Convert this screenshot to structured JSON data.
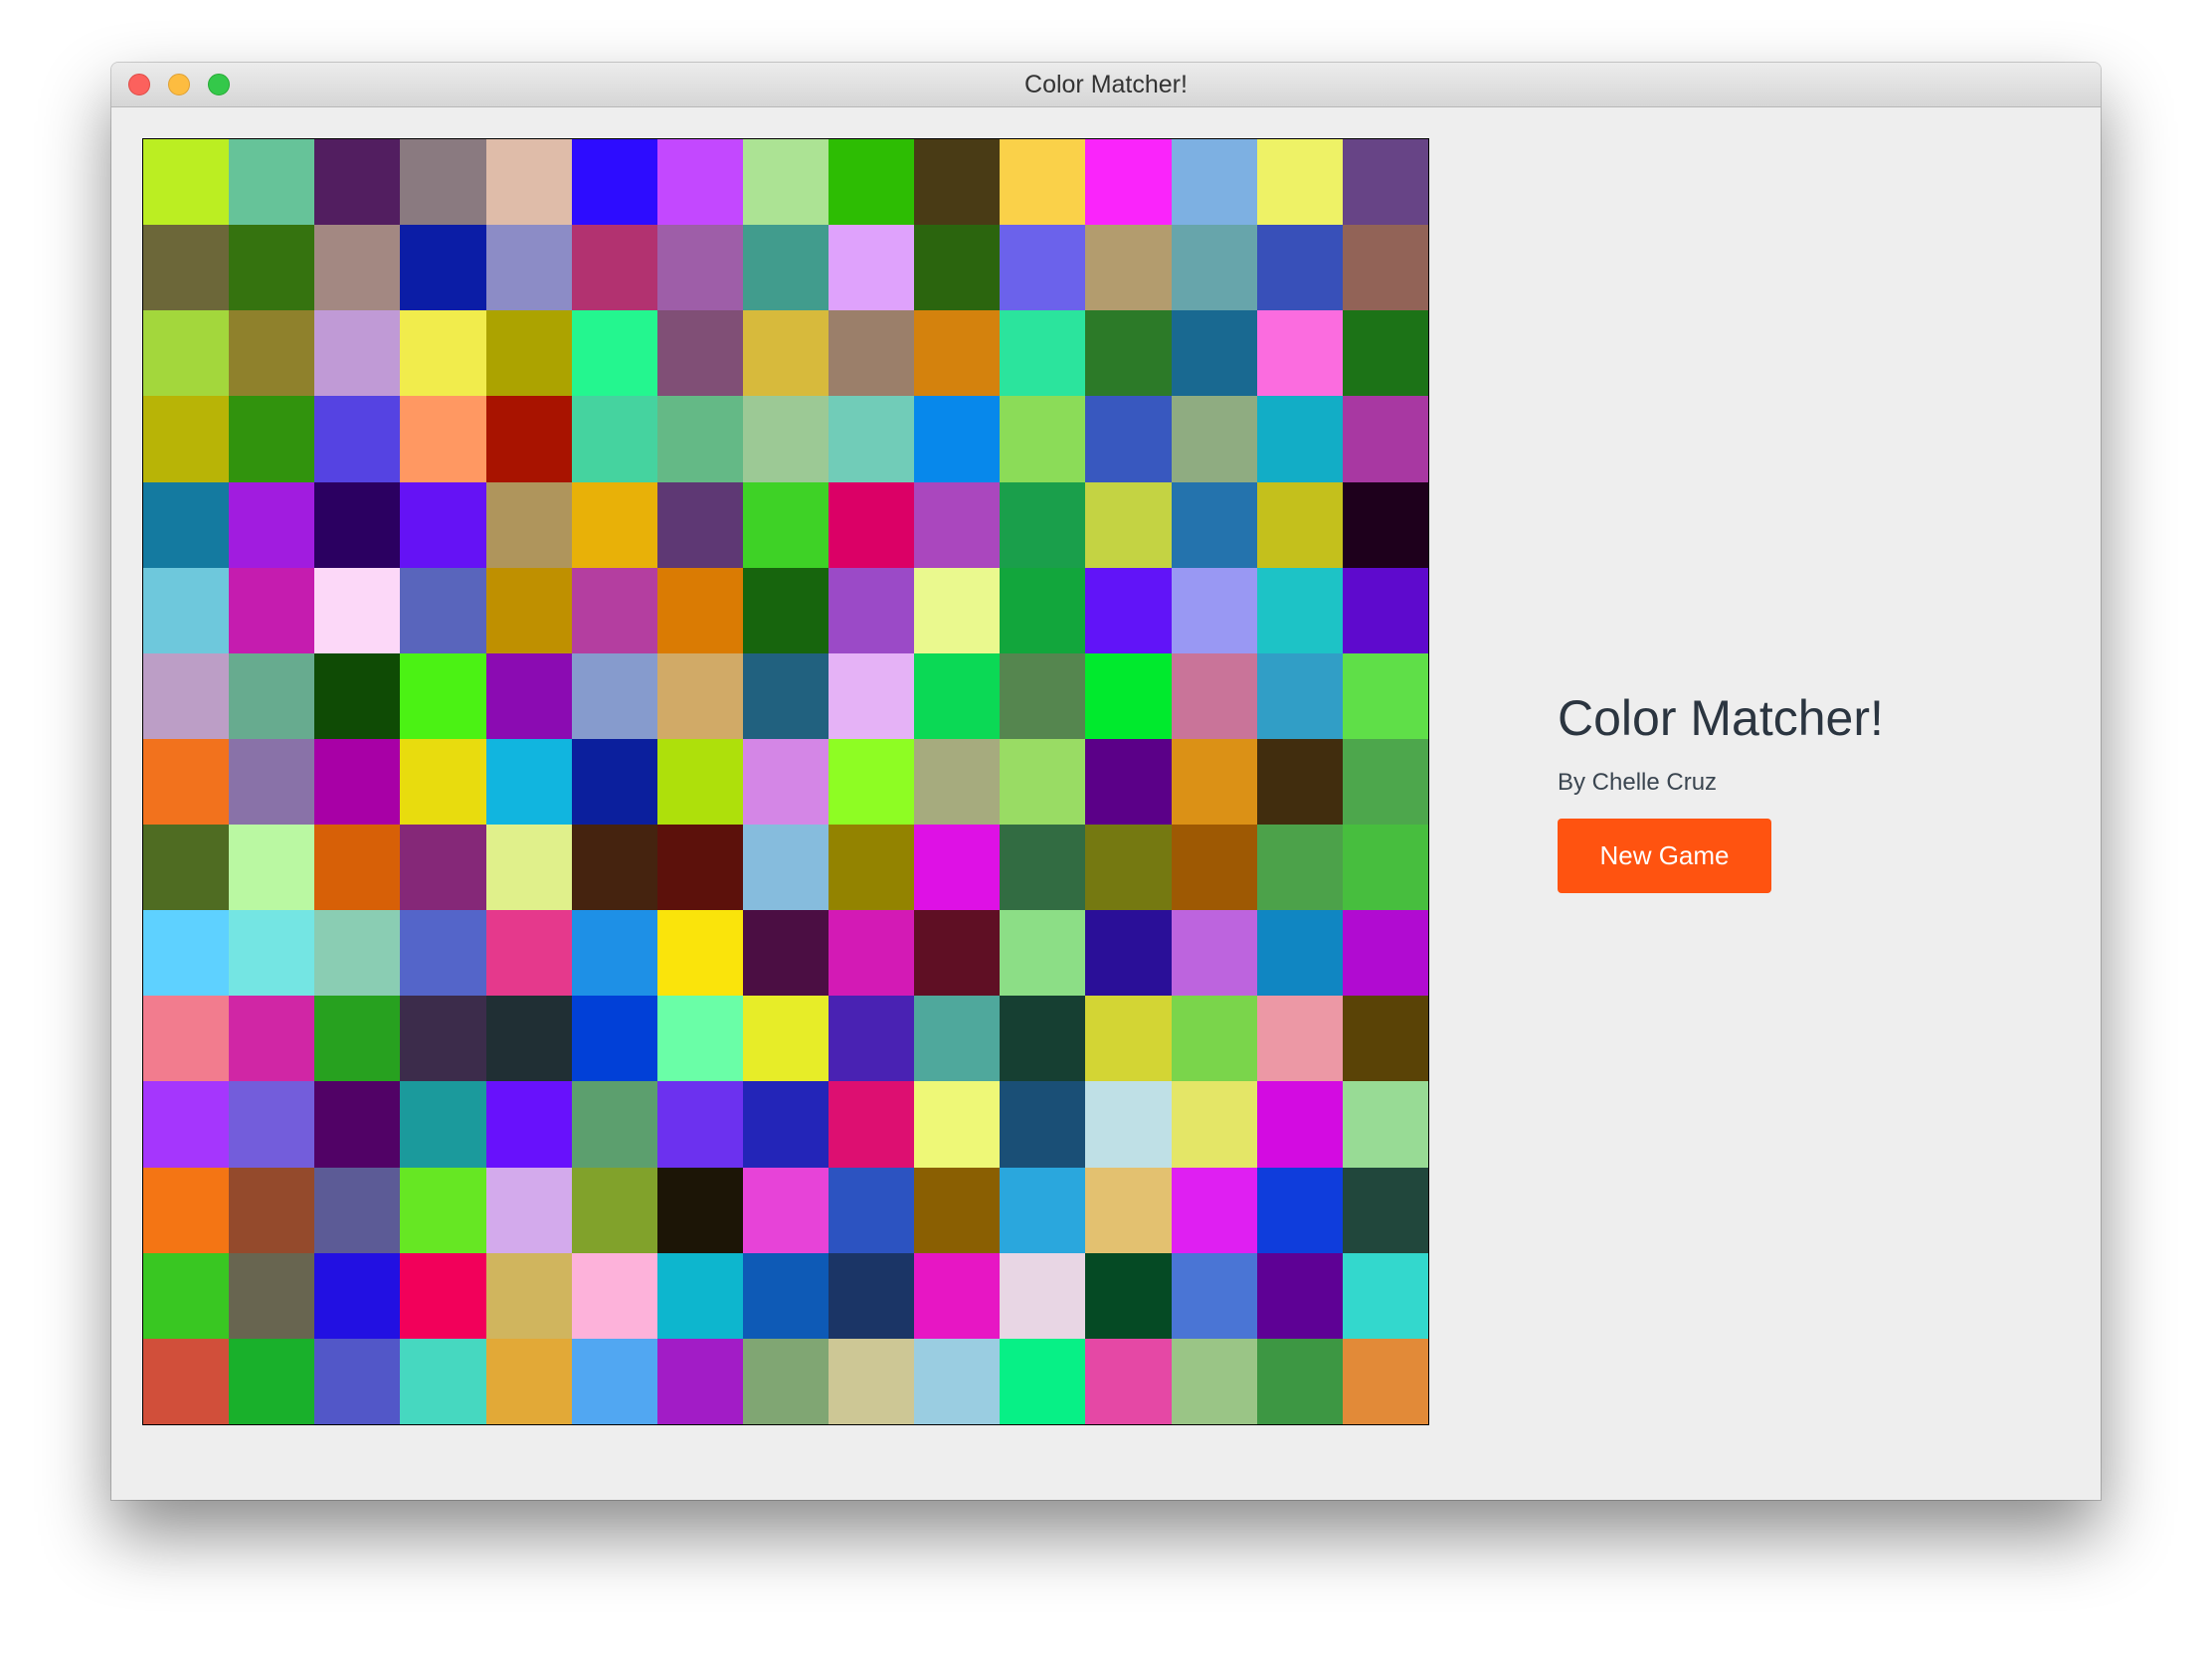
{
  "window": {
    "title": "Color Matcher!"
  },
  "info": {
    "heading": "Color Matcher!",
    "byline": "By Chelle Cruz",
    "new_game_label": "New Game",
    "button_color": "#ff5310"
  },
  "board": {
    "rows": 15,
    "cols": 15,
    "colors": [
      [
        "#bbee22",
        "#66c399",
        "#521e60",
        "#8a7a80",
        "#dfbca9",
        "#2d0cff",
        "#c348ff",
        "#ace394",
        "#2dbd03",
        "#493b15",
        "#fad149",
        "#fa24fb",
        "#7db0e2",
        "#eef266",
        "#674486"
      ],
      [
        "#6c6739",
        "#35730f",
        "#a38882",
        "#0b1da6",
        "#8c8cc6",
        "#b23270",
        "#9e5ea8",
        "#419c8d",
        "#dfa2fc",
        "#2b650e",
        "#6b62eb",
        "#b39c6e",
        "#67a5ab",
        "#3850b9",
        "#926357"
      ],
      [
        "#a3d73c",
        "#8f812c",
        "#c09ad6",
        "#f1ec4c",
        "#aca300",
        "#24f68f",
        "#804f76",
        "#d7ba3c",
        "#9b7f6a",
        "#d4820d",
        "#2be49d",
        "#2c7a28",
        "#196991",
        "#fb6cdf",
        "#1c7317"
      ],
      [
        "#b8b406",
        "#31930d",
        "#5543e2",
        "#ff9862",
        "#a81300",
        "#45d39f",
        "#64b986",
        "#9cc995",
        "#71ccb8",
        "#0788eb",
        "#8bdc58",
        "#3858bf",
        "#8fac81",
        "#12adc6",
        "#a838a2"
      ],
      [
        "#147aa0",
        "#a11cdf",
        "#2b0061",
        "#6512f5",
        "#af955c",
        "#e8b108",
        "#5e3874",
        "#3ed226",
        "#db0066",
        "#aa47be",
        "#1a9f4b",
        "#c4d343",
        "#2473ad",
        "#c4c01c",
        "#1e001c"
      ],
      [
        "#6ec8dc",
        "#c51caf",
        "#fcd8f8",
        "#5965bc",
        "#bf9000",
        "#b43ea0",
        "#da7b03",
        "#17650d",
        "#9b4ac7",
        "#eaf98e",
        "#12a63c",
        "#6114f8",
        "#9998f3",
        "#1dc3c6",
        "#5e0acd"
      ],
      [
        "#bc9ec6",
        "#67ab8f",
        "#0f4b05",
        "#4bf214",
        "#8b0bb2",
        "#869bcd",
        "#d1aa67",
        "#21617f",
        "#e5b2f6",
        "#0bd955",
        "#55864f",
        "#00ea2d",
        "#c97499",
        "#319ec6",
        "#5fdf48"
      ],
      [
        "#f2721d",
        "#8972a8",
        "#a800a6",
        "#e8dc0e",
        "#11b5df",
        "#0b1f9d",
        "#aee00b",
        "#d486e6",
        "#8efd23",
        "#a6ab7e",
        "#99dc64",
        "#5b0088",
        "#db9116",
        "#412d0e",
        "#4da74c"
      ],
      [
        "#4f6c22",
        "#baf8a2",
        "#d76007",
        "#852878",
        "#e0f08b",
        "#45230f",
        "#5c110b",
        "#86bcdd",
        "#938300",
        "#de11e5",
        "#326c42",
        "#757911",
        "#9e5903",
        "#4ca24a",
        "#47be3e"
      ],
      [
        "#5ed1ff",
        "#74e5e3",
        "#8acdb3",
        "#5465c9",
        "#e5398c",
        "#1e90e6",
        "#fae40b",
        "#4b0e43",
        "#d31ab5",
        "#5f0f24",
        "#8cde86",
        "#2a0f98",
        "#bd64de",
        "#1086c2",
        "#b10bd1"
      ],
      [
        "#f27c8e",
        "#d026a5",
        "#27a11f",
        "#3c2c4b",
        "#202f34",
        "#0140d7",
        "#6afea7",
        "#e7ed28",
        "#4922b3",
        "#4fa89c",
        "#163f32",
        "#d3d534",
        "#7ad54b",
        "#ec98a5",
        "#5a4306"
      ],
      [
        "#a536fd",
        "#735ddb",
        "#510266",
        "#1b9a9c",
        "#6811fc",
        "#5c9f6e",
        "#6c31ef",
        "#2325b8",
        "#dd0f71",
        "#eef877",
        "#1a4f76",
        "#bfe0e6",
        "#e4e667",
        "#d30be1",
        "#98db95"
      ],
      [
        "#f47514",
        "#944a2c",
        "#5c5b96",
        "#66e723",
        "#d3aaec",
        "#81a22b",
        "#1c1506",
        "#e743d8",
        "#2c53c1",
        "#8a5f02",
        "#2aa7dd",
        "#e3c170",
        "#df1ff2",
        "#0f3ddc",
        "#21473c"
      ],
      [
        "#39c722",
        "#686550",
        "#2210e2",
        "#f2005a",
        "#d0b55e",
        "#fdb2da",
        "#0db6ce",
        "#0e5ab6",
        "#1b3566",
        "#e716c4",
        "#e8d6e4",
        "#054a24",
        "#4a75d5",
        "#5e0195",
        "#33d8cd"
      ],
      [
        "#d14f3a",
        "#19b02b",
        "#5257c8",
        "#46d8c0",
        "#e2a937",
        "#51a7f2",
        "#a21cc6",
        "#80a673",
        "#cdc795",
        "#9acde1",
        "#07f086",
        "#e548a5",
        "#9ac586",
        "#3d9743",
        "#e28a38"
      ]
    ]
  }
}
